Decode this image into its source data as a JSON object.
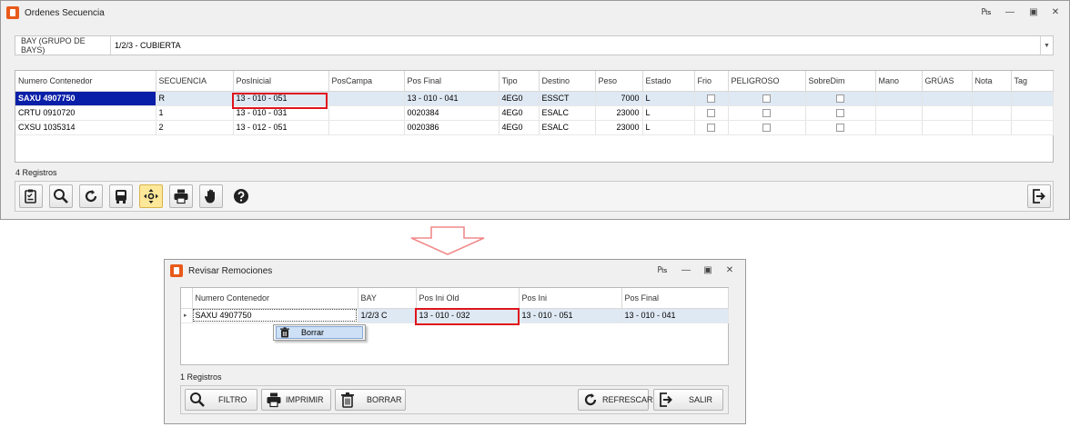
{
  "window1": {
    "title": "Ordenes Secuencia",
    "bay": {
      "label": "BAY (GRUPO DE BAYS)",
      "value": "1/2/3 - CUBIERTA"
    },
    "columns": [
      "Numero Contenedor",
      "SECUENCIA",
      "PosInicial",
      "PosCampa",
      "Pos Final",
      "Tipo",
      "Destino",
      "Peso",
      "Estado",
      "Frio",
      "PELIGROSO",
      "SobreDim",
      "Mano",
      "GRÚAS",
      "Nota",
      "Tag"
    ],
    "rows": [
      {
        "contenedor": "SAXU 4907750",
        "secuencia": "R",
        "pos_inicial": "13 - 010 - 051",
        "pos_campa": "",
        "pos_final": "13 - 010 - 041",
        "tipo": "4EG0",
        "destino": "ESSCT",
        "peso": "7000",
        "estado": "L"
      },
      {
        "contenedor": "CRTU 0910720",
        "secuencia": "1",
        "pos_inicial": "13 - 010 - 031",
        "pos_campa": "",
        "pos_final": "0020384",
        "tipo": "4EG0",
        "destino": "ESALC",
        "peso": "23000",
        "estado": "L"
      },
      {
        "contenedor": "CXSU 1035314",
        "secuencia": "2",
        "pos_inicial": "13 - 012 - 051",
        "pos_campa": "",
        "pos_final": "0020386",
        "tipo": "4EG0",
        "destino": "ESALC",
        "peso": "23000",
        "estado": "L"
      }
    ],
    "record_count": "4 Registros",
    "toolbar_icons": [
      "clipboard-icon",
      "search-icon",
      "refresh-icon",
      "truck-icon",
      "move-icon",
      "print-icon",
      "hand-icon",
      "help-icon"
    ],
    "exit_icon": "exit-icon"
  },
  "window2": {
    "title": "Revisar Remociones",
    "columns": [
      "Numero Contenedor",
      "BAY",
      "Pos Ini Old",
      "Pos Ini",
      "Pos Final"
    ],
    "rows": [
      {
        "contenedor": "SAXU 4907750",
        "bay": "1/2/3 C",
        "pos_ini_old": "13 - 010 - 032",
        "pos_ini": "13 - 010 - 051",
        "pos_final": "13 - 010 - 041"
      }
    ],
    "context_menu": {
      "item": "Borrar"
    },
    "record_count": "1 Registros",
    "buttons": {
      "filtro": "FILTRO",
      "imprimir": "IMPRIMIR",
      "borrar": "BORRAR",
      "refrescar": "REFRESCAR",
      "salir": "SALIR"
    }
  },
  "colors": {
    "accent_selection": "#0a1fa8",
    "highlight_box": "#e0141c",
    "row_selection": "#dfe9f4",
    "arrow": "#f08a8a"
  }
}
